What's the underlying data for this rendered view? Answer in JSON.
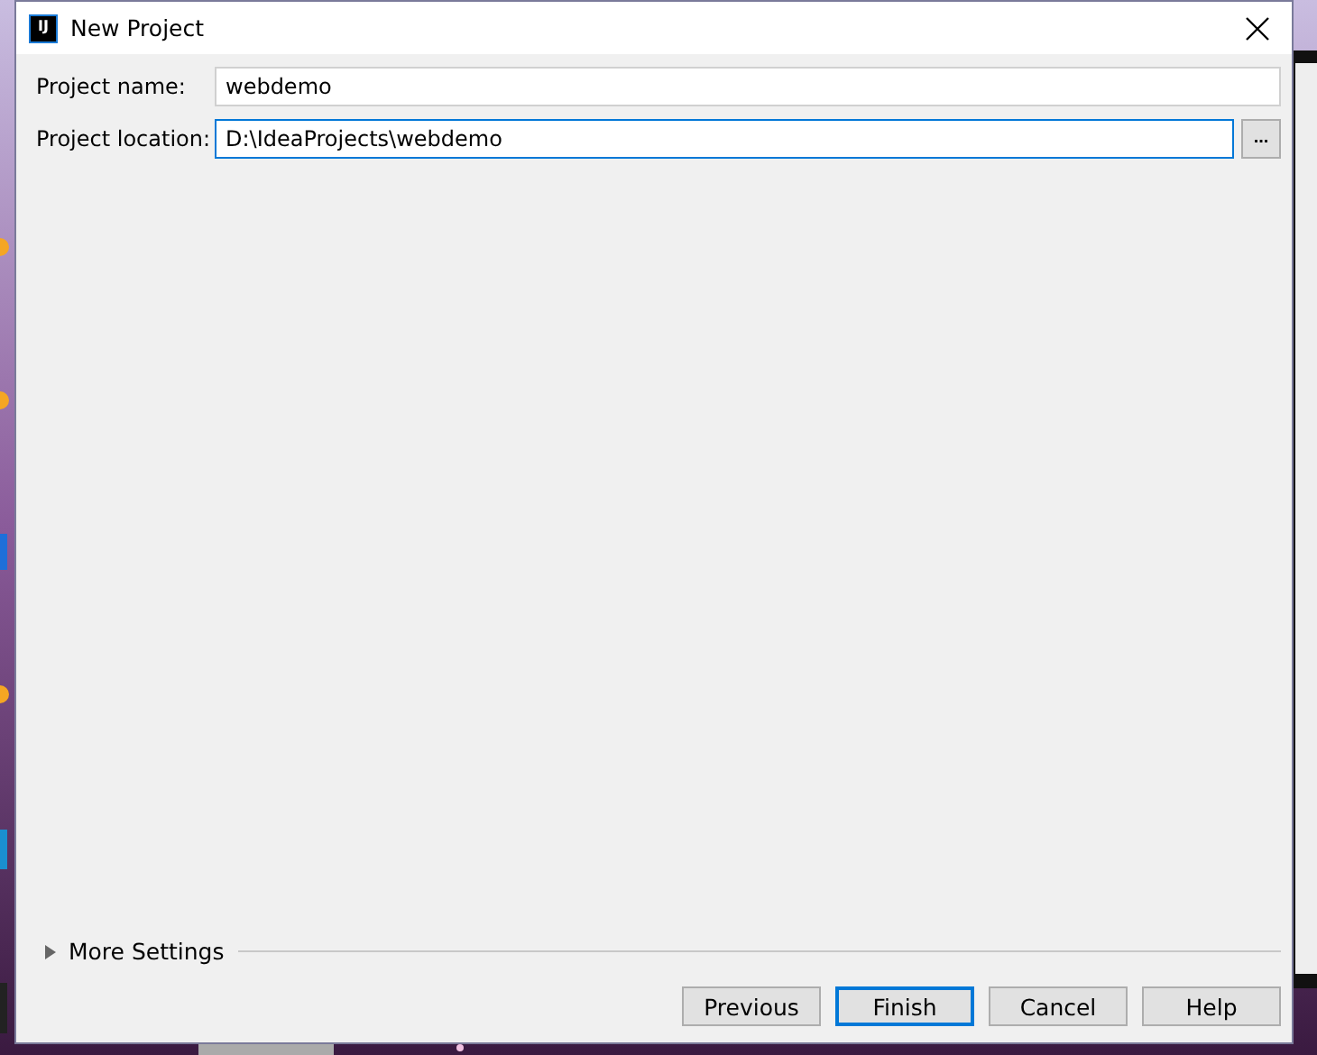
{
  "window": {
    "title": "New Project",
    "logo": "IJ"
  },
  "fields": [
    {
      "label": "Project name:",
      "value": "webdemo",
      "focused": false
    },
    {
      "label": "Project location:",
      "value": "D:\\IdeaProjects\\webdemo",
      "focused": true,
      "browse": "..."
    }
  ],
  "more_settings": {
    "label": "More Settings",
    "expanded": false
  },
  "buttons": [
    {
      "label": "Previous",
      "default": false
    },
    {
      "label": "Finish",
      "default": true
    },
    {
      "label": "Cancel",
      "default": false
    },
    {
      "label": "Help",
      "default": false
    }
  ]
}
